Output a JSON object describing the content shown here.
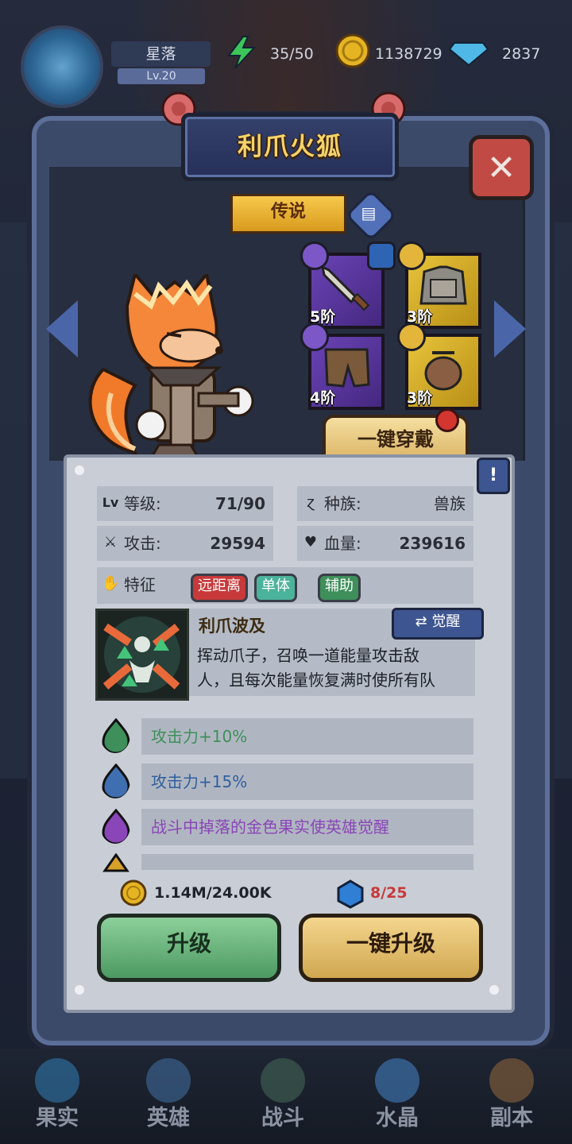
{
  "player": {
    "name": "星落",
    "level": "Lv.20"
  },
  "resources": {
    "energy": "35/50",
    "gold": "1138729",
    "gems": "2837"
  },
  "hero": {
    "name": "利爪火狐",
    "rarity": "传说",
    "equip_all": "一键穿戴",
    "equipment": [
      {
        "slot": "weapon",
        "tier": "5阶",
        "quality": "purple"
      },
      {
        "slot": "armor",
        "tier": "3阶",
        "quality": "gold"
      },
      {
        "slot": "pants",
        "tier": "4阶",
        "quality": "purple"
      },
      {
        "slot": "accessory",
        "tier": "3阶",
        "quality": "gold"
      }
    ]
  },
  "stats": {
    "level_label": "等级:",
    "level_value": "71/90",
    "race_label": "种族:",
    "race_value": "兽族",
    "attack_label": "攻击:",
    "attack_value": "29594",
    "hp_label": "血量:",
    "hp_value": "239616",
    "traits_label": "特征",
    "traits": [
      "远距离",
      "单体",
      "辅助"
    ]
  },
  "skill": {
    "name": "利爪波及",
    "awaken_label": "觉醒",
    "desc_line1": "挥动爪子，召唤一道能量攻击敌",
    "desc_line2": "人，且每次能量恢复满时使所有队"
  },
  "buffs": [
    {
      "text": "攻击力+10%",
      "color": "#3e8f5a"
    },
    {
      "text": "攻击力+15%",
      "color": "#3f6fb0"
    },
    {
      "text": "战斗中掉落的金色果实使英雄觉醒",
      "color": "#8a45b8"
    },
    {
      "text": "",
      "color": "#d6a02a"
    }
  ],
  "upgrade": {
    "coin_cost": "1.14M/24.00K",
    "crystal_cost": "8/25",
    "upgrade_label": "升级",
    "upgrade_all_label": "一键升级"
  },
  "nav": [
    {
      "label": "果实"
    },
    {
      "label": "英雄"
    },
    {
      "label": "战斗"
    },
    {
      "label": "水晶"
    },
    {
      "label": "副本"
    }
  ],
  "colors": {
    "title": "#f6d36a",
    "accent_blue": "#4b66a8",
    "red_tag": "#c8393a",
    "green_tag": "#3e8f5a"
  }
}
